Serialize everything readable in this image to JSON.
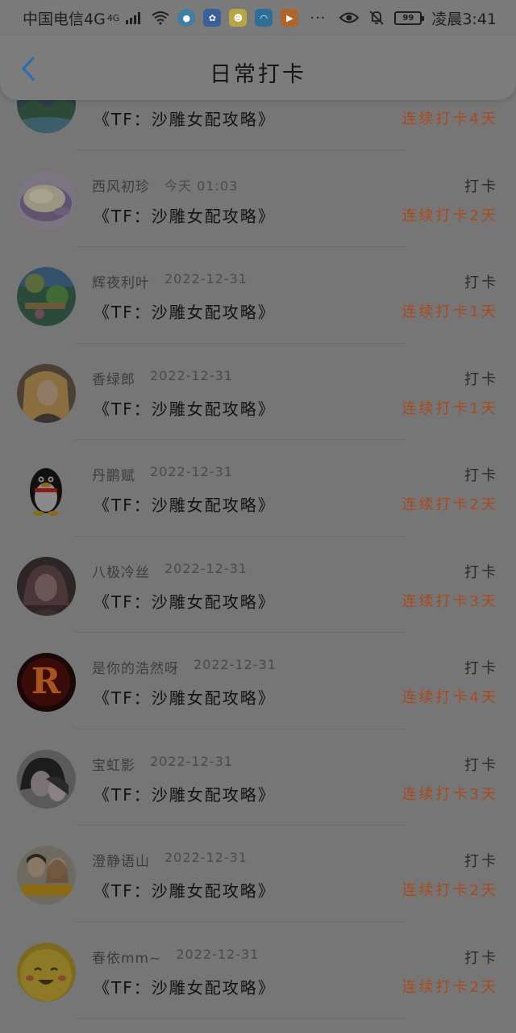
{
  "status_bar": {
    "carrier": "中国电信4G",
    "network_badge": "4G",
    "battery": "99",
    "time": "凌晨3:41",
    "more": "···"
  },
  "header": {
    "title": "日常打卡"
  },
  "colors": {
    "streak_text": "#a84a1e",
    "back_arrow": "#2a6fae"
  },
  "list": {
    "items": [
      {
        "name": "",
        "time": "",
        "title": "《TF：沙雕女配攻略》",
        "action": "",
        "streak": "连续打卡4天",
        "avatar": "landscape-avatar"
      },
      {
        "name": "西风初珍",
        "time": "今天 01:03",
        "title": "《TF：沙雕女配攻略》",
        "action": "打卡",
        "streak": "连续打卡2天",
        "avatar": "food-bowl-avatar"
      },
      {
        "name": "辉夜利叶",
        "time": "2022-12-31",
        "title": "《TF：沙雕女配攻略》",
        "action": "打卡",
        "streak": "连续打卡1天",
        "avatar": "garden-avatar"
      },
      {
        "name": "香绿郎",
        "time": "2022-12-31",
        "title": "《TF：沙雕女配攻略》",
        "action": "打卡",
        "streak": "连续打卡1天",
        "avatar": "portrait-avatar"
      },
      {
        "name": "丹鹏赋",
        "time": "2022-12-31",
        "title": "《TF：沙雕女配攻略》",
        "action": "打卡",
        "streak": "连续打卡2天",
        "avatar": "penguin-avatar"
      },
      {
        "name": "八极冷丝",
        "time": "2022-12-31",
        "title": "《TF：沙雕女配攻略》",
        "action": "打卡",
        "streak": "连续打卡3天",
        "avatar": "anime-girl-avatar"
      },
      {
        "name": "是你的浩然呀",
        "time": "2022-12-31",
        "title": "《TF：沙雕女配攻略》",
        "action": "打卡",
        "streak": "连续打卡4天",
        "avatar": "letter-r-avatar"
      },
      {
        "name": "宝虹影",
        "time": "2022-12-31",
        "title": "《TF：沙雕女配攻略》",
        "action": "打卡",
        "streak": "连续打卡3天",
        "avatar": "anime-couple-avatar"
      },
      {
        "name": "澄静语山",
        "time": "2022-12-31",
        "title": "《TF：沙雕女配攻略》",
        "action": "打卡",
        "streak": "连续打卡2天",
        "avatar": "couple-photo-avatar"
      },
      {
        "name": "春依mm~",
        "time": "2022-12-31",
        "title": "《TF：沙雕女配攻略》",
        "action": "打卡",
        "streak": "连续打卡2天",
        "avatar": "smiley-avatar"
      }
    ]
  }
}
